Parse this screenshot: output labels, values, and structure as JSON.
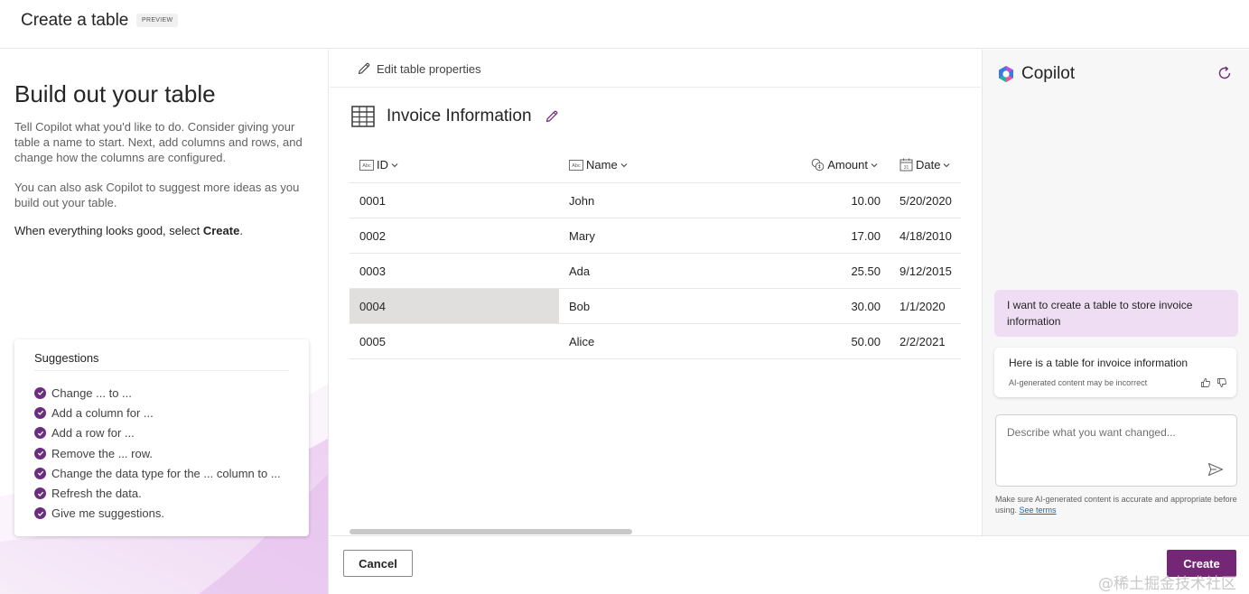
{
  "header": {
    "title": "Create a table",
    "badge": "PREVIEW"
  },
  "left_panel": {
    "heading": "Build out your table",
    "paragraph1": "Tell Copilot what you'd like to do. Consider giving your table a name to start. Next, add columns and rows, and change how the columns are configured.",
    "paragraph2": "You can also ask Copilot to suggest more ideas as you build out your table.",
    "paragraph3_prefix": "When everything looks good, select ",
    "paragraph3_bold": "Create",
    "paragraph3_suffix": ".",
    "suggestions": {
      "title": "Suggestions",
      "items": [
        "Change ... to ...",
        "Add a column for ...",
        "Add a row for ...",
        "Remove the ... row.",
        "Change the data type for the ... column to ...",
        "Refresh the data.",
        "Give me suggestions."
      ]
    }
  },
  "center": {
    "edit_properties_label": "Edit table properties",
    "table_name": "Invoice Information",
    "columns": [
      "ID",
      "Name",
      "Amount",
      "Date"
    ],
    "rows": [
      [
        "0001",
        "John",
        "10.00",
        "5/20/2020"
      ],
      [
        "0002",
        "Mary",
        "17.00",
        "4/18/2010"
      ],
      [
        "0003",
        "Ada",
        "25.50",
        "9/12/2015"
      ],
      [
        "0004",
        "Bob",
        "30.00",
        "1/1/2020"
      ],
      [
        "0005",
        "Alice",
        "50.00",
        "2/2/2021"
      ]
    ]
  },
  "copilot": {
    "title": "Copilot",
    "user_message": "I want to create a table to store invoice information",
    "assistant_message": "Here is a table for invoice information",
    "disclaimer": "AI-generated content may be incorrect",
    "input_placeholder": "Describe what you want changed...",
    "footer_text": "Make sure AI-generated content is accurate and appropriate before using. ",
    "footer_link": "See terms"
  },
  "footer": {
    "cancel_label": "Cancel",
    "create_label": "Create"
  },
  "watermark": "@稀土掘金技术社区",
  "colors": {
    "accent": "#742774",
    "check": "#6b2d7e",
    "selected_cell": "#e1dfdd",
    "user_bubble": "#efdef3"
  }
}
